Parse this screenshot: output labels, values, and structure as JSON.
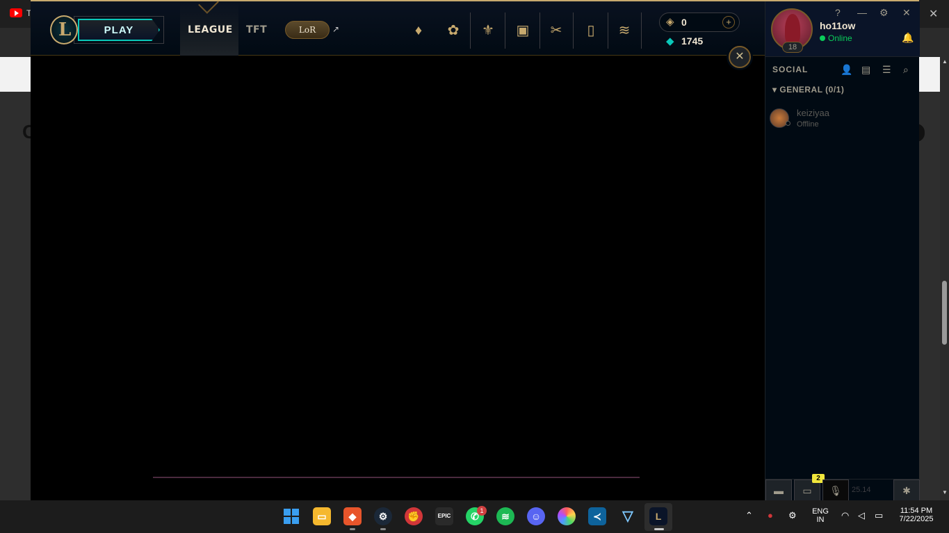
{
  "client": {
    "play_label": "PLAY",
    "nav": {
      "league": "LEAGUE",
      "tft": "TFT",
      "lor": "LoR",
      "lor_ext": "↗"
    },
    "currency": {
      "rp": "0",
      "blue_essence": "1745",
      "plus": "+"
    },
    "close_overlay": "✕"
  },
  "social": {
    "summoner_name": "ho11ow",
    "status": "Online",
    "level": "18",
    "window_controls": {
      "help": "?",
      "minimize": "—",
      "settings": "⚙",
      "close": "✕"
    },
    "title": "SOCIAL",
    "group": "GENERAL (0/1)",
    "friends": [
      {
        "name": "keiziyaa",
        "status": "Offline"
      }
    ],
    "footer": {
      "badge": "2",
      "version": "25.14"
    }
  },
  "taskbar": {
    "epic_label": "EPIC",
    "whatsapp_badge": "1",
    "lang_top": "ENG",
    "lang_bottom": "IN",
    "time": "11:54 PM",
    "date": "7/22/2025",
    "tray_up": "⌃"
  },
  "colors": {
    "gold": "#c8aa6e",
    "teal": "#0ac8b9",
    "online": "#0acd5a"
  }
}
